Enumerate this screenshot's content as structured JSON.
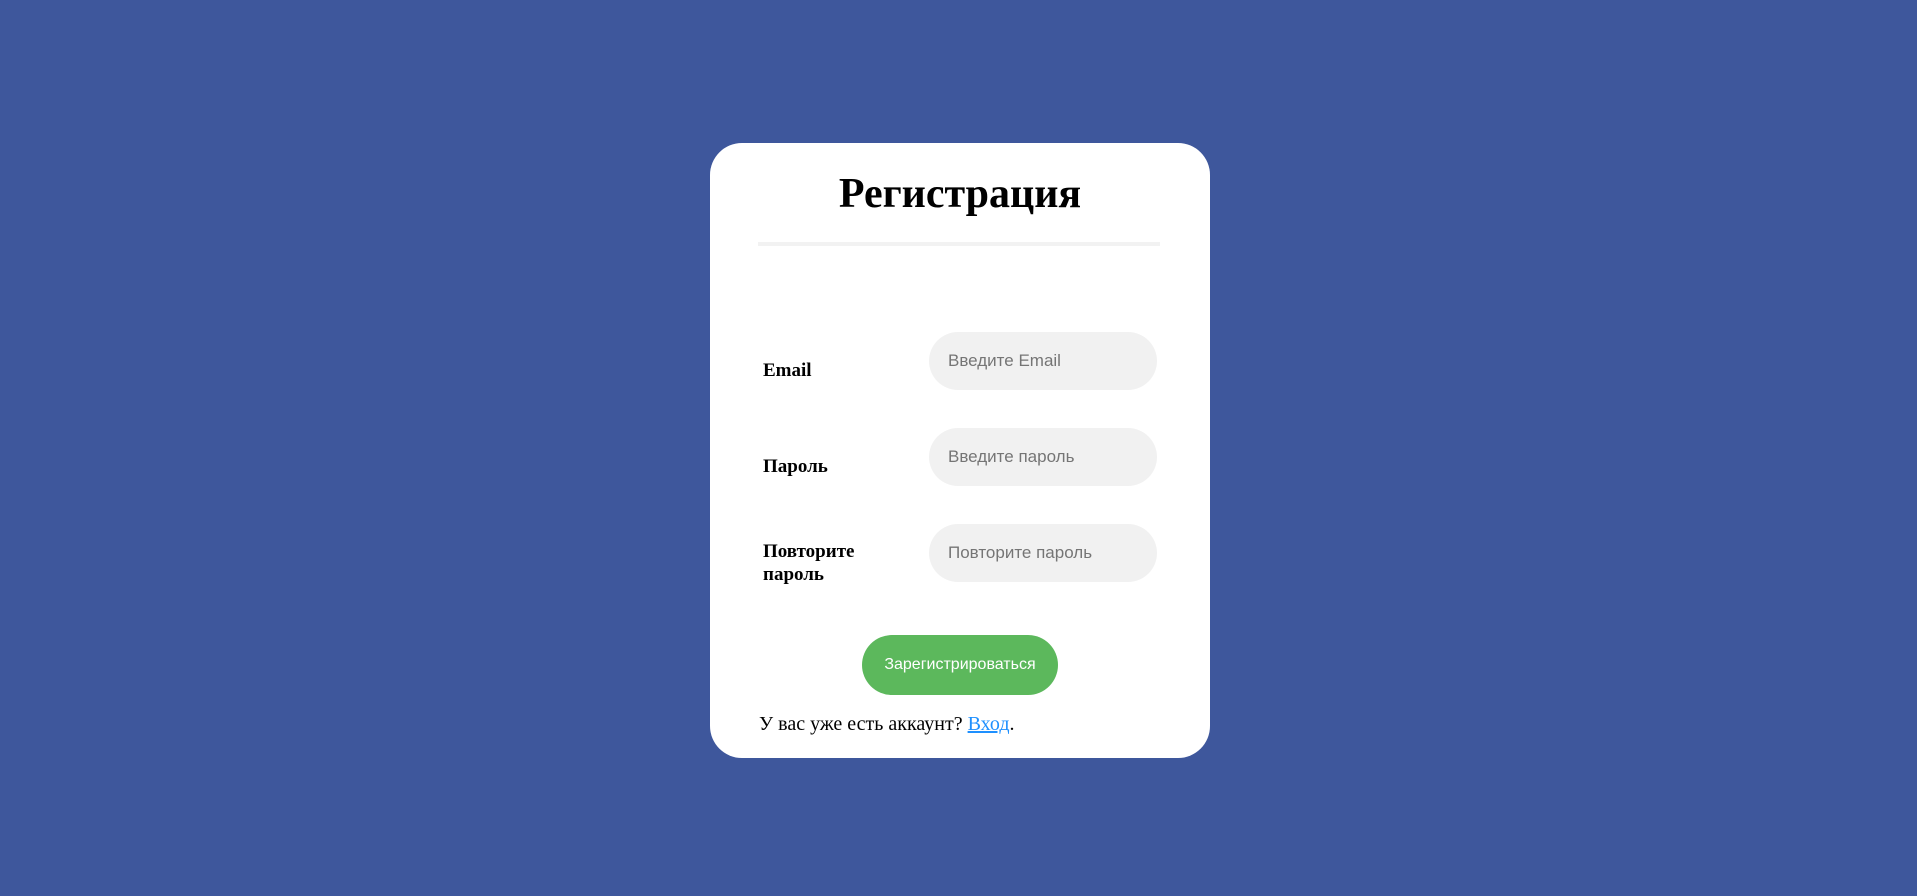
{
  "colors": {
    "background": "#3e579c",
    "card": "#ffffff",
    "input_background": "#f1f1f1",
    "button": "#5cb85c",
    "link": "#1e90ff"
  },
  "form": {
    "title": "Регистрация",
    "fields": [
      {
        "label": "Email",
        "placeholder": "Введите Email",
        "value": ""
      },
      {
        "label": "Пароль",
        "placeholder": "Введите пароль",
        "value": ""
      },
      {
        "label": "Повторите пароль",
        "placeholder": "Повторите пароль",
        "value": ""
      }
    ],
    "submit_label": "Зарегистрироваться",
    "footer": {
      "prefix": "У вас уже есть аккаунт? ",
      "link_text": "Вход",
      "suffix": "."
    }
  }
}
